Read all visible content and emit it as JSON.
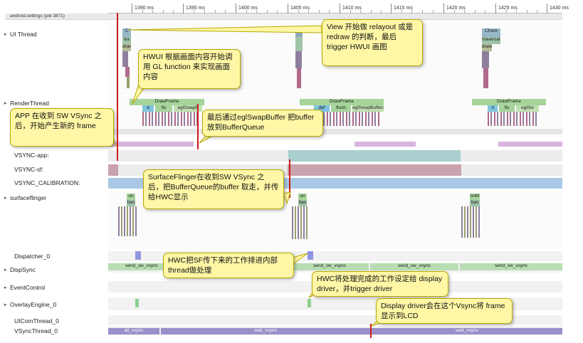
{
  "ruler": {
    "ticks": [
      "1390 ms",
      "1395 ms",
      "1400 ms",
      "1405 ms",
      "1410 ms",
      "1415 ms",
      "1420 ms",
      "1425 ms",
      "1430 ms"
    ]
  },
  "process": {
    "title": "android.settings (pid 3871)"
  },
  "tracks": [
    "UI Thread",
    "RenderThread",
    "VSYNC-app:",
    "VSYNC-sf:",
    "VSYNC_CALIBRATION:",
    "surfaceflinger",
    "Dispatcher_0",
    "DispSync",
    "EventControl",
    "OverlayEngine_0",
    "UIComThread_0",
    "VSyncThread_0"
  ],
  "slices": {
    "ui_c1": "C",
    "ui_tra1": "tra",
    "ui_draw1": "draw",
    "ui_choreo": "Chore",
    "ui_traversal": "traversal",
    "ui_draw3": "draw",
    "rt_drawframe1": "DrawFrame",
    "rt_d1": "d",
    "rt_flu1": "flu",
    "rt_egl1": "eglSwapB",
    "rt_drawframe2": "DrawFrame",
    "rt_def2": "def",
    "rt_flush2": "flush",
    "rt_egl2": "eglSwapBuffers",
    "rt_drawframe3": "DrawFrame",
    "rt_d3": "d",
    "rt_flu3": "flu",
    "rt_egl3": "eglSw",
    "sf_on1": "on",
    "sf_han1": "han",
    "sf_on2": "on",
    "sf_han2": "han",
    "sf_onm": "onM",
    "sf_han3": "han",
    "ds_1": "send_sw_vsync",
    "ds_2": "send_sw_vsync",
    "ds_3": "send_sw_vsync",
    "ds_4": "send_sw_vsync",
    "vt_1": "ait_vsync",
    "vt_2": "wait_vsync",
    "vt_3": "wait_vsync"
  },
  "callouts": {
    "view": "View 开始做 relayout 或是 redraw 的判断，最后 trigger HWUI 画图",
    "hwui": "HWUI 根据画面内容开始调用 GL function 来实现画面内容",
    "app": "APP 在收到 SW VSync 之后，开始产生新的 frame",
    "egl": "最后通过eglSwapBuffer 把buffer放到BufferQueue",
    "sf": "SurfaceFlinger在收到SW VSync 之后，把BufferQueue的buffer 取走，并传给HWC显示",
    "hwc1": "HWC把SF传下来的工作排进内部thread做处理",
    "hwc2": "HWC将处理完成的工作设定给 display driver，并trigger driver",
    "display": "Display driver会在这个Vsync将 frame显示到LCD"
  }
}
